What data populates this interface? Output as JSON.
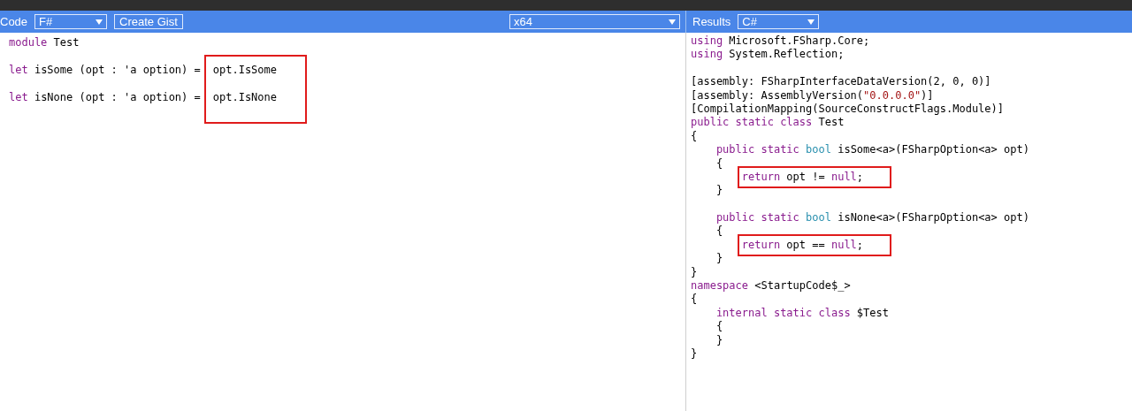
{
  "toolbar": {
    "code_label": "Code",
    "language_select": "F#",
    "create_gist_button": "Create Gist",
    "platform_select": "x64",
    "results_label": "Results",
    "results_select": "C#"
  },
  "code_pane": {
    "sections": [
      {
        "kind": "plain",
        "lines": [
          {
            "tokens": [
              {
                "kind": "keyword",
                "text": "module"
              },
              {
                "kind": "plain",
                "text": " Test"
              }
            ]
          }
        ]
      },
      {
        "kind": "boxed_right",
        "rows": [
          {
            "left": [
              {
                "kind": "keyword",
                "text": "let"
              },
              {
                "kind": "plain",
                "text": " isSome (opt : 'a option) ="
              }
            ],
            "right": [
              {
                "kind": "plain",
                "text": "opt.IsSome"
              }
            ]
          },
          {
            "left": [
              {
                "kind": "keyword",
                "text": "let"
              },
              {
                "kind": "plain",
                "text": " isNone (opt : 'a option) ="
              }
            ],
            "right": [
              {
                "kind": "plain",
                "text": "opt.IsNone"
              }
            ]
          }
        ]
      }
    ]
  },
  "results_pane": {
    "sections": [
      [
        {
          "tokens": [
            {
              "kind": "keyword",
              "text": "using"
            },
            {
              "kind": "plain",
              "text": " Microsoft.FSharp.Core;"
            }
          ]
        },
        {
          "tokens": [
            {
              "kind": "keyword",
              "text": "using"
            },
            {
              "kind": "plain",
              "text": " System.Reflection;"
            }
          ]
        }
      ],
      [
        {
          "tokens": [
            {
              "kind": "plain",
              "text": "[assembly: FSharpInterfaceDataVersion(2, 0, 0)]"
            }
          ]
        },
        {
          "tokens": [
            {
              "kind": "plain",
              "text": "[assembly: AssemblyVersion("
            },
            {
              "kind": "string",
              "text": "\"0.0.0.0\""
            },
            {
              "kind": "plain",
              "text": ")]"
            }
          ]
        },
        {
          "tokens": [
            {
              "kind": "plain",
              "text": "[CompilationMapping(SourceConstructFlags.Module)]"
            }
          ]
        },
        {
          "tokens": [
            {
              "kind": "keyword",
              "text": "public static class"
            },
            {
              "kind": "plain",
              "text": " Test"
            }
          ]
        },
        {
          "tokens": [
            {
              "kind": "plain",
              "text": "{"
            }
          ],
          "children": [
            [
              {
                "tokens": [
                  {
                    "kind": "keyword",
                    "text": "public static"
                  },
                  {
                    "kind": "type",
                    "text": "bool"
                  },
                  {
                    "kind": "plain",
                    "text": "isSome<a>(FSharpOption<a> opt)"
                  }
                ]
              },
              {
                "tokens": [
                  {
                    "kind": "plain",
                    "text": "{"
                  }
                ],
                "children": [
                  [
                    {
                      "boxed": true,
                      "tokens": [
                        {
                          "kind": "keyword",
                          "text": "return"
                        },
                        {
                          "kind": "plain",
                          "text": " opt != "
                        },
                        {
                          "kind": "keyword",
                          "text": "null"
                        },
                        {
                          "kind": "plain",
                          "text": ";"
                        }
                      ]
                    }
                  ]
                ]
              },
              {
                "tokens": [
                  {
                    "kind": "plain",
                    "text": "}"
                  }
                ]
              }
            ],
            [
              {
                "tokens": [
                  {
                    "kind": "keyword",
                    "text": "public static"
                  },
                  {
                    "kind": "type",
                    "text": "bool"
                  },
                  {
                    "kind": "plain",
                    "text": "isNone<a>(FSharpOption<a> opt)"
                  }
                ]
              },
              {
                "tokens": [
                  {
                    "kind": "plain",
                    "text": "{"
                  }
                ],
                "children": [
                  [
                    {
                      "boxed": true,
                      "tokens": [
                        {
                          "kind": "keyword",
                          "text": "return"
                        },
                        {
                          "kind": "plain",
                          "text": " opt == "
                        },
                        {
                          "kind": "keyword",
                          "text": "null"
                        },
                        {
                          "kind": "plain",
                          "text": ";"
                        }
                      ]
                    }
                  ]
                ]
              },
              {
                "tokens": [
                  {
                    "kind": "plain",
                    "text": "}"
                  }
                ]
              }
            ]
          ]
        },
        {
          "tokens": [
            {
              "kind": "plain",
              "text": "}"
            }
          ]
        },
        {
          "tokens": [
            {
              "kind": "keyword",
              "text": "namespace"
            },
            {
              "kind": "plain",
              "text": " <StartupCode$_>"
            }
          ]
        },
        {
          "tokens": [
            {
              "kind": "plain",
              "text": "{"
            }
          ],
          "children": [
            [
              {
                "tokens": [
                  {
                    "kind": "keyword",
                    "text": "internal static class"
                  },
                  {
                    "kind": "plain",
                    "text": " $Test"
                  }
                ]
              },
              {
                "tokens": [
                  {
                    "kind": "plain",
                    "text": "{"
                  }
                ]
              },
              {
                "tokens": [
                  {
                    "kind": "plain",
                    "text": "}"
                  }
                ]
              }
            ]
          ]
        },
        {
          "tokens": [
            {
              "kind": "plain",
              "text": "}"
            }
          ]
        }
      ]
    ]
  }
}
